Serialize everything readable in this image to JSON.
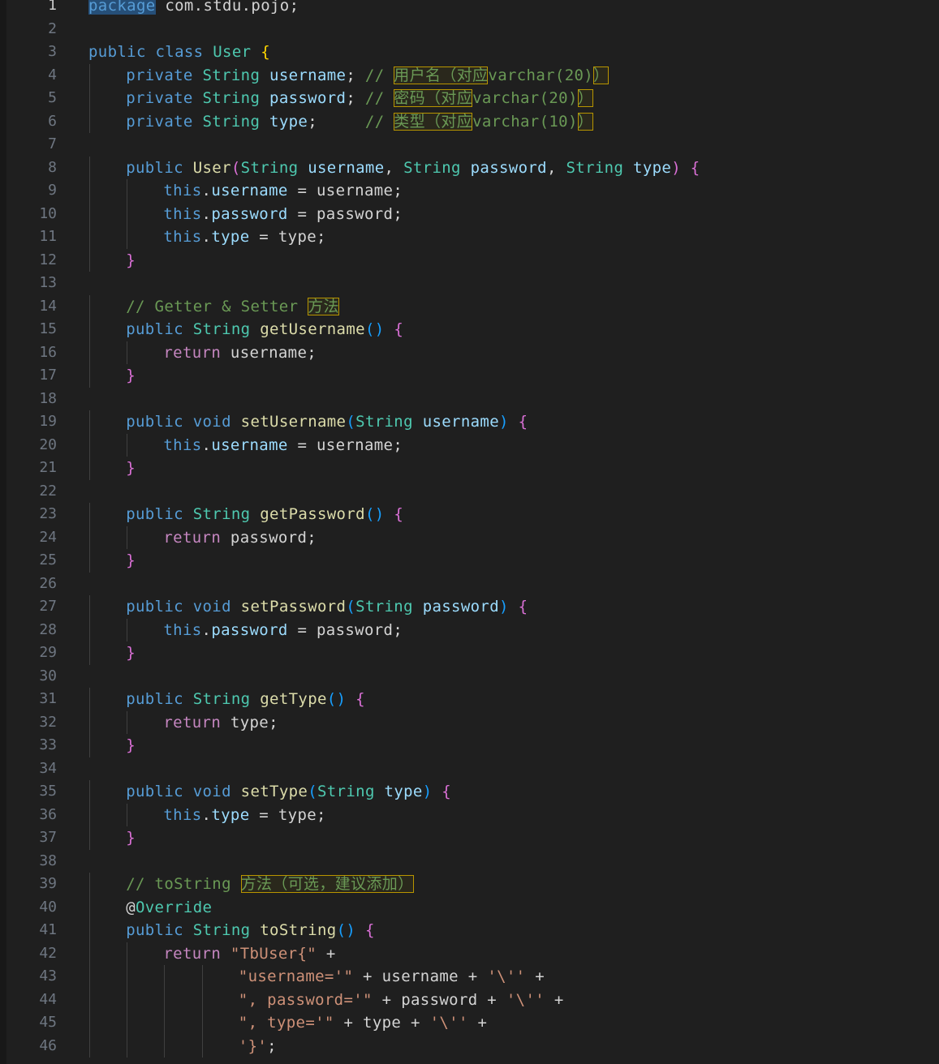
{
  "editor": {
    "language": "java",
    "active_line": 1,
    "lines": [
      {
        "n": 1,
        "indent": 0,
        "tokens": [
          [
            "package",
            "kw-blue sel"
          ],
          [
            " com.stdu.pojo;",
            "plain"
          ]
        ]
      },
      {
        "n": 2,
        "indent": 0,
        "tokens": []
      },
      {
        "n": 3,
        "indent": 0,
        "tokens": [
          [
            "public class ",
            "kw-blue"
          ],
          [
            "User",
            "type"
          ],
          [
            " ",
            "plain"
          ],
          [
            "{",
            "b1"
          ]
        ]
      },
      {
        "n": 4,
        "indent": 1,
        "tokens": [
          [
            "private ",
            "kw-blue"
          ],
          [
            "String ",
            "type"
          ],
          [
            "username",
            "var"
          ],
          [
            "; ",
            "plain"
          ],
          [
            "// ",
            "cmt"
          ],
          [
            "用户名（对应",
            "cmt warn cjk"
          ],
          [
            "varchar(20)",
            "cmt"
          ],
          [
            "）",
            "cmt warn cjk"
          ]
        ]
      },
      {
        "n": 5,
        "indent": 1,
        "tokens": [
          [
            "private ",
            "kw-blue"
          ],
          [
            "String ",
            "type"
          ],
          [
            "password",
            "var"
          ],
          [
            "; ",
            "plain"
          ],
          [
            "// ",
            "cmt"
          ],
          [
            "密码（对应",
            "cmt warn cjk"
          ],
          [
            "varchar(20)",
            "cmt"
          ],
          [
            "）",
            "cmt warn cjk"
          ]
        ]
      },
      {
        "n": 6,
        "indent": 1,
        "tokens": [
          [
            "private ",
            "kw-blue"
          ],
          [
            "String ",
            "type"
          ],
          [
            "type",
            "var"
          ],
          [
            ";     ",
            "plain"
          ],
          [
            "// ",
            "cmt"
          ],
          [
            "类型（对应",
            "cmt warn cjk"
          ],
          [
            "varchar(10)",
            "cmt"
          ],
          [
            "）",
            "cmt warn cjk"
          ]
        ]
      },
      {
        "n": 7,
        "indent": 0,
        "tokens": []
      },
      {
        "n": 8,
        "indent": 1,
        "tokens": [
          [
            "public ",
            "kw-blue"
          ],
          [
            "User",
            "fn"
          ],
          [
            "(",
            "b2"
          ],
          [
            "String ",
            "type"
          ],
          [
            "username",
            "var"
          ],
          [
            ", ",
            "plain"
          ],
          [
            "String ",
            "type"
          ],
          [
            "password",
            "var"
          ],
          [
            ", ",
            "plain"
          ],
          [
            "String ",
            "type"
          ],
          [
            "type",
            "var"
          ],
          [
            ")",
            "b2"
          ],
          [
            " ",
            "plain"
          ],
          [
            "{",
            "b2"
          ]
        ]
      },
      {
        "n": 9,
        "indent": 2,
        "tokens": [
          [
            "this",
            "kw-blue"
          ],
          [
            ".",
            "plain"
          ],
          [
            "username",
            "var"
          ],
          [
            " = username;",
            "plain"
          ]
        ]
      },
      {
        "n": 10,
        "indent": 2,
        "tokens": [
          [
            "this",
            "kw-blue"
          ],
          [
            ".",
            "plain"
          ],
          [
            "password",
            "var"
          ],
          [
            " = password;",
            "plain"
          ]
        ]
      },
      {
        "n": 11,
        "indent": 2,
        "tokens": [
          [
            "this",
            "kw-blue"
          ],
          [
            ".",
            "plain"
          ],
          [
            "type",
            "var"
          ],
          [
            " = type;",
            "plain"
          ]
        ]
      },
      {
        "n": 12,
        "indent": 1,
        "tokens": [
          [
            "}",
            "b2"
          ]
        ]
      },
      {
        "n": 13,
        "indent": 0,
        "tokens": []
      },
      {
        "n": 14,
        "indent": 1,
        "tokens": [
          [
            "// Getter & Setter ",
            "cmt"
          ],
          [
            "方法",
            "cmt warn cjk"
          ]
        ]
      },
      {
        "n": 15,
        "indent": 1,
        "tokens": [
          [
            "public ",
            "kw-blue"
          ],
          [
            "String ",
            "type"
          ],
          [
            "getUsername",
            "fn"
          ],
          [
            "()",
            "b3"
          ],
          [
            " ",
            "plain"
          ],
          [
            "{",
            "b2"
          ]
        ]
      },
      {
        "n": 16,
        "indent": 2,
        "tokens": [
          [
            "return ",
            "kw-pink"
          ],
          [
            "username;",
            "plain"
          ]
        ]
      },
      {
        "n": 17,
        "indent": 1,
        "tokens": [
          [
            "}",
            "b2"
          ]
        ]
      },
      {
        "n": 18,
        "indent": 0,
        "tokens": []
      },
      {
        "n": 19,
        "indent": 1,
        "tokens": [
          [
            "public ",
            "kw-blue"
          ],
          [
            "void ",
            "kw-blue"
          ],
          [
            "setUsername",
            "fn"
          ],
          [
            "(",
            "b3"
          ],
          [
            "String ",
            "type"
          ],
          [
            "username",
            "var"
          ],
          [
            ")",
            "b3"
          ],
          [
            " ",
            "plain"
          ],
          [
            "{",
            "b2"
          ]
        ]
      },
      {
        "n": 20,
        "indent": 2,
        "tokens": [
          [
            "this",
            "kw-blue"
          ],
          [
            ".",
            "plain"
          ],
          [
            "username",
            "var"
          ],
          [
            " = username;",
            "plain"
          ]
        ]
      },
      {
        "n": 21,
        "indent": 1,
        "tokens": [
          [
            "}",
            "b2"
          ]
        ]
      },
      {
        "n": 22,
        "indent": 0,
        "tokens": []
      },
      {
        "n": 23,
        "indent": 1,
        "tokens": [
          [
            "public ",
            "kw-blue"
          ],
          [
            "String ",
            "type"
          ],
          [
            "getPassword",
            "fn"
          ],
          [
            "()",
            "b3"
          ],
          [
            " ",
            "plain"
          ],
          [
            "{",
            "b2"
          ]
        ]
      },
      {
        "n": 24,
        "indent": 2,
        "tokens": [
          [
            "return ",
            "kw-pink"
          ],
          [
            "password;",
            "plain"
          ]
        ]
      },
      {
        "n": 25,
        "indent": 1,
        "tokens": [
          [
            "}",
            "b2"
          ]
        ]
      },
      {
        "n": 26,
        "indent": 0,
        "tokens": []
      },
      {
        "n": 27,
        "indent": 1,
        "tokens": [
          [
            "public ",
            "kw-blue"
          ],
          [
            "void ",
            "kw-blue"
          ],
          [
            "setPassword",
            "fn"
          ],
          [
            "(",
            "b3"
          ],
          [
            "String ",
            "type"
          ],
          [
            "password",
            "var"
          ],
          [
            ")",
            "b3"
          ],
          [
            " ",
            "plain"
          ],
          [
            "{",
            "b2"
          ]
        ]
      },
      {
        "n": 28,
        "indent": 2,
        "tokens": [
          [
            "this",
            "kw-blue"
          ],
          [
            ".",
            "plain"
          ],
          [
            "password",
            "var"
          ],
          [
            " = password;",
            "plain"
          ]
        ]
      },
      {
        "n": 29,
        "indent": 1,
        "tokens": [
          [
            "}",
            "b2"
          ]
        ]
      },
      {
        "n": 30,
        "indent": 0,
        "tokens": []
      },
      {
        "n": 31,
        "indent": 1,
        "tokens": [
          [
            "public ",
            "kw-blue"
          ],
          [
            "String ",
            "type"
          ],
          [
            "getType",
            "fn"
          ],
          [
            "()",
            "b3"
          ],
          [
            " ",
            "plain"
          ],
          [
            "{",
            "b2"
          ]
        ]
      },
      {
        "n": 32,
        "indent": 2,
        "tokens": [
          [
            "return ",
            "kw-pink"
          ],
          [
            "type;",
            "plain"
          ]
        ]
      },
      {
        "n": 33,
        "indent": 1,
        "tokens": [
          [
            "}",
            "b2"
          ]
        ]
      },
      {
        "n": 34,
        "indent": 0,
        "tokens": []
      },
      {
        "n": 35,
        "indent": 1,
        "tokens": [
          [
            "public ",
            "kw-blue"
          ],
          [
            "void ",
            "kw-blue"
          ],
          [
            "setType",
            "fn"
          ],
          [
            "(",
            "b3"
          ],
          [
            "String ",
            "type"
          ],
          [
            "type",
            "var"
          ],
          [
            ")",
            "b3"
          ],
          [
            " ",
            "plain"
          ],
          [
            "{",
            "b2"
          ]
        ]
      },
      {
        "n": 36,
        "indent": 2,
        "tokens": [
          [
            "this",
            "kw-blue"
          ],
          [
            ".",
            "plain"
          ],
          [
            "type",
            "var"
          ],
          [
            " = type;",
            "plain"
          ]
        ]
      },
      {
        "n": 37,
        "indent": 1,
        "tokens": [
          [
            "}",
            "b2"
          ]
        ]
      },
      {
        "n": 38,
        "indent": 0,
        "tokens": []
      },
      {
        "n": 39,
        "indent": 1,
        "tokens": [
          [
            "// toString ",
            "cmt"
          ],
          [
            "方法（可选，建议添加）",
            "cmt warn cjk"
          ]
        ]
      },
      {
        "n": 40,
        "indent": 1,
        "tokens": [
          [
            "@",
            "plain"
          ],
          [
            "Override",
            "type"
          ]
        ]
      },
      {
        "n": 41,
        "indent": 1,
        "tokens": [
          [
            "public ",
            "kw-blue"
          ],
          [
            "String ",
            "type"
          ],
          [
            "toString",
            "fn"
          ],
          [
            "()",
            "b3"
          ],
          [
            " ",
            "plain"
          ],
          [
            "{",
            "b2"
          ]
        ]
      },
      {
        "n": 42,
        "indent": 2,
        "tokens": [
          [
            "return ",
            "kw-pink"
          ],
          [
            "\"TbUser{\"",
            "str"
          ],
          [
            " +",
            "plain"
          ]
        ]
      },
      {
        "n": 43,
        "indent": 4,
        "tokens": [
          [
            "\"username='\"",
            "str"
          ],
          [
            " + username + ",
            "plain"
          ],
          [
            "'\\''",
            "str"
          ],
          [
            " +",
            "plain"
          ]
        ]
      },
      {
        "n": 44,
        "indent": 4,
        "tokens": [
          [
            "\", password='\"",
            "str"
          ],
          [
            " + password + ",
            "plain"
          ],
          [
            "'\\''",
            "str"
          ],
          [
            " +",
            "plain"
          ]
        ]
      },
      {
        "n": 45,
        "indent": 4,
        "tokens": [
          [
            "\", type='\"",
            "str"
          ],
          [
            " + type + ",
            "plain"
          ],
          [
            "'\\''",
            "str"
          ],
          [
            " +",
            "plain"
          ]
        ]
      },
      {
        "n": 46,
        "indent": 4,
        "tokens": [
          [
            "'}'",
            "str"
          ],
          [
            ";",
            "plain"
          ]
        ]
      }
    ]
  }
}
